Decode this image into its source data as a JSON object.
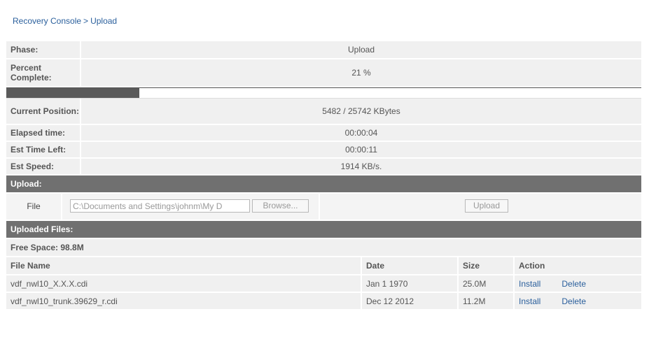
{
  "breadcrumb": {
    "parent": "Recovery Console",
    "separator": ">",
    "current": "Upload"
  },
  "stats": [
    {
      "label": "Phase:",
      "value": "Upload"
    },
    {
      "label": "Percent Complete:",
      "value": "21 %"
    },
    {
      "label": "Current Position:",
      "value": "5482 / 25742 KBytes"
    },
    {
      "label": "Elapsed time:",
      "value": "00:00:04"
    },
    {
      "label": "Est Time Left:",
      "value": "00:00:11"
    },
    {
      "label": "Est Speed:",
      "value": "1914 KB/s."
    }
  ],
  "progress": {
    "percent": 21,
    "fill_color": "#5a5a5a"
  },
  "upload": {
    "header": "Upload:",
    "file_label": "File",
    "file_value": "C:\\Documents and Settings\\johnm\\My D",
    "browse_label": "Browse...",
    "upload_label": "Upload"
  },
  "uploaded": {
    "header": "Uploaded Files:",
    "free_space": "Free Space: 98.8M",
    "columns": {
      "name": "File Name",
      "date": "Date",
      "size": "Size",
      "action": "Action"
    },
    "rows": [
      {
        "name": "vdf_nwl10_X.X.X.cdi",
        "date": "Jan 1 1970",
        "size": "25.0M",
        "install": "Install",
        "delete": "Delete"
      },
      {
        "name": "vdf_nwl10_trunk.39629_r.cdi",
        "date": "Dec 12 2012",
        "size": "11.2M",
        "install": "Install",
        "delete": "Delete"
      }
    ]
  },
  "colors": {
    "link": "#2a5f9c",
    "section_header": "#707070",
    "row_bg": "#f0f0f0"
  }
}
